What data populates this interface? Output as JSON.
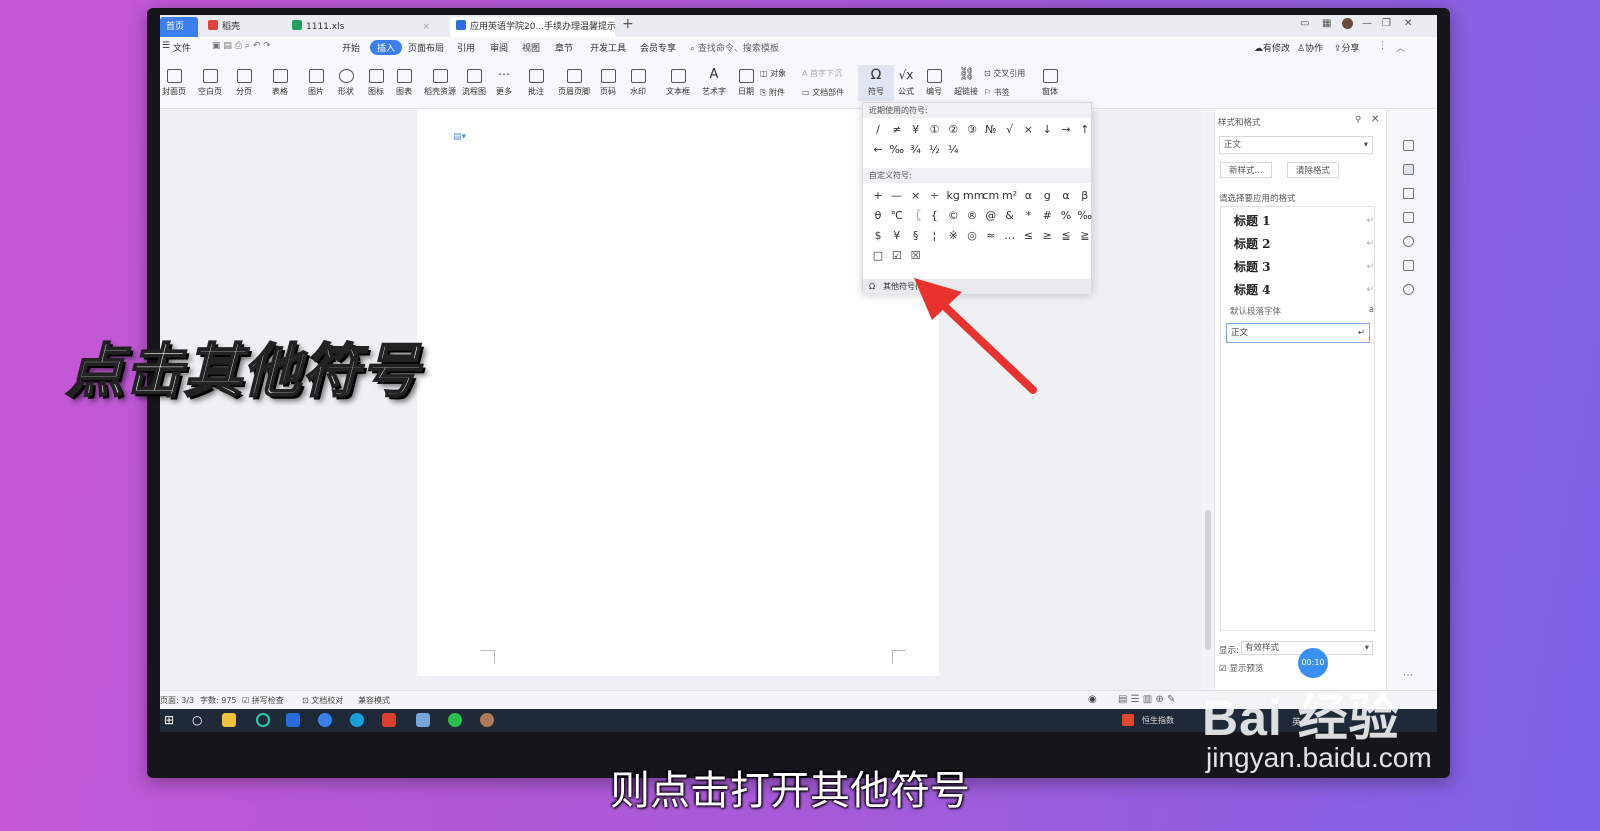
{
  "tabs": {
    "home": "首页",
    "shell": "稻壳",
    "xls": "1111.xls",
    "doc": "应用英语学院20...手续办理温馨提示"
  },
  "menu": [
    "文件",
    "开始",
    "插入",
    "页面布局",
    "引用",
    "审阅",
    "视图",
    "章节",
    "开发工具",
    "会员专享"
  ],
  "menu_search": "查找命令、搜索模板",
  "menu_right": {
    "unsaved": "有修改",
    "collab": "协作",
    "share": "分享"
  },
  "ribbon": {
    "cover": "封面页",
    "blank": "空白页",
    "pagebreak": "分页",
    "table": "表格",
    "picture": "图片",
    "shape": "形状",
    "icon": "图标",
    "chart": "图表",
    "shell_res": "稻壳资源",
    "flow": "流程图",
    "more": "更多",
    "comment": "批注",
    "header_footer": "页眉页脚",
    "page_num": "页码",
    "watermark": "水印",
    "textbox": "文本框",
    "wordart": "艺术字",
    "date": "日期",
    "object": "对象",
    "attachment": "附件",
    "dropcap": "首字下沉",
    "docpart": "文档部件",
    "symbol": "符号",
    "formula": "公式",
    "numbering": "编号",
    "hyperlink": "超链接",
    "crossref": "交叉引用",
    "bookmark": "书签",
    "window": "窗体"
  },
  "dropdown": {
    "recent_title": "近期使用的符号:",
    "recent": [
      "/",
      "≠",
      "¥",
      "①",
      "②",
      "③",
      "№",
      "√",
      "×",
      "↓",
      "→",
      "↑",
      "←",
      "‰",
      "¾",
      "½",
      "¼"
    ],
    "custom_title": "自定义符号:",
    "custom": [
      "+",
      "—",
      "×",
      "÷",
      "kg",
      "mm",
      "cm",
      "m²",
      "α",
      "g",
      "α",
      "β",
      "θ",
      "℃",
      "〖",
      "{",
      "©",
      "®",
      "@",
      "&",
      "*",
      "#",
      "%",
      "‰",
      "$",
      "¥",
      "§",
      "¦",
      "※",
      "◎",
      "≈",
      "…",
      "≤",
      "≥",
      "≦",
      "≧",
      "□",
      "☑",
      "☒"
    ],
    "more": "其他符号(M)..."
  },
  "panel": {
    "title": "样式和格式",
    "current_style": "正文",
    "new_style": "新样式...",
    "clear_format": "清除格式",
    "choose_label": "请选择要应用的格式",
    "styles": [
      "标题 1",
      "标题 2",
      "标题 3",
      "标题 4"
    ],
    "default_font": "默认段落字体",
    "body": "正文",
    "show_label": "显示:",
    "show_value": "有效样式",
    "preview_label": "显示预览"
  },
  "status": {
    "page": "页面: 3/3",
    "words": "字数: 975",
    "spell": "拼写检查",
    "proof": "文档校对",
    "compat": "兼容模式"
  },
  "taskbar": {
    "fund": "恒生指数",
    "ime": "英"
  },
  "timer": "00:10",
  "caption": "点击其他符号",
  "subtitle": "则点击打开其他符号",
  "watermark": {
    "logo": "Bai 经验",
    "url": "jingyan.baidu.com"
  },
  "colors": {
    "accent": "#3a7ef0",
    "arrow": "#e8322d",
    "taskbar": "#1f2a38"
  }
}
